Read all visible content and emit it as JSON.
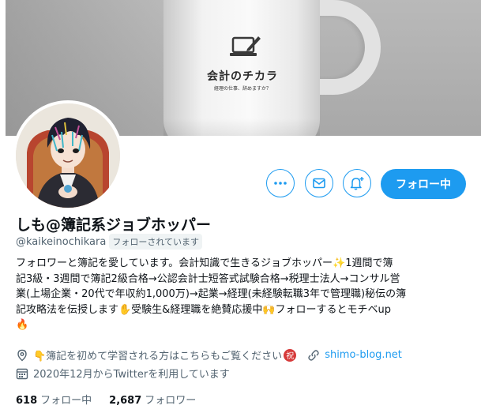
{
  "banner": {
    "brand": "会計のチカラ",
    "tagline": "経理の仕事、辞めますか？"
  },
  "actions": {
    "more_icon": "more-dots-icon",
    "message_icon": "mail-icon",
    "notify_icon": "bell-plus-icon",
    "follow_label": "フォロー中",
    "accent_color": "#1d9bf0"
  },
  "profile": {
    "display_name": "しも@簿記系ジョブホッパー",
    "handle": "@kaikeinochikara",
    "follows_you": "フォローされています",
    "bio_lines": [
      "フォロワーと簿記を愛しています。会計知識で生きるジョブホッパー✨1週間で簿",
      "記3級・3週間で簿記2級合格→公認会計士短答式試験合格→税理士法人→コンサル営",
      "業(上場企業・20代で年収約1,000万)→起業→経理(未経験転職3年で管理職)秘伝の簿",
      "記攻略法を伝授します✋受験生&経理職を絶賛応援中🙌フォローするとモチベup",
      "🔥"
    ],
    "location": "👇簿記を初めて学習される方はこちらもご覧ください",
    "location_badge": "祝",
    "website": "shimo-blog.net",
    "joined": "2020年12月からTwitterを利用しています"
  },
  "stats": {
    "following_count": "618",
    "following_label": "フォロー中",
    "followers_count": "2,687",
    "followers_label": "フォロワー"
  }
}
